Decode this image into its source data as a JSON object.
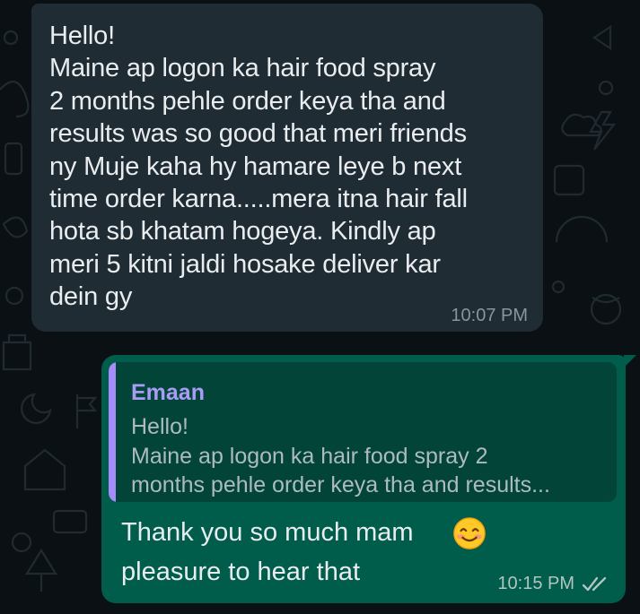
{
  "theme": {
    "background": "#0b1014",
    "incoming_bubble": "#202c33",
    "outgoing_bubble": "#005c4b",
    "quote_background": "#024538",
    "quote_accent": "#a78bfa",
    "text": "#e9edef",
    "timestamp": "#8696a0"
  },
  "messages": {
    "incoming": {
      "text": "Hello!\nMaine ap logon ka hair food spray\n2 months pehle order keya tha and\nresults was so good that meri friends\nny Muje kaha hy hamare leye b next\ntime order karna.....mera itna hair fall\nhota sb khatam hogeya. Kindly ap\nmeri 5 kitni jaldi hosake deliver kar\ndein gy",
      "time": "10:07 PM"
    },
    "outgoing": {
      "quoted_author": "Emaan",
      "quoted_text": "Hello!\nMaine ap logon ka hair food spray 2\nmonths pehle order keya tha and results...",
      "text": "Thank you so much mam\npleasure to hear that",
      "emoji": "smiling-face-with-smiling-eyes-emoji",
      "time": "10:15 PM",
      "status_icon": "double-check-icon"
    }
  }
}
